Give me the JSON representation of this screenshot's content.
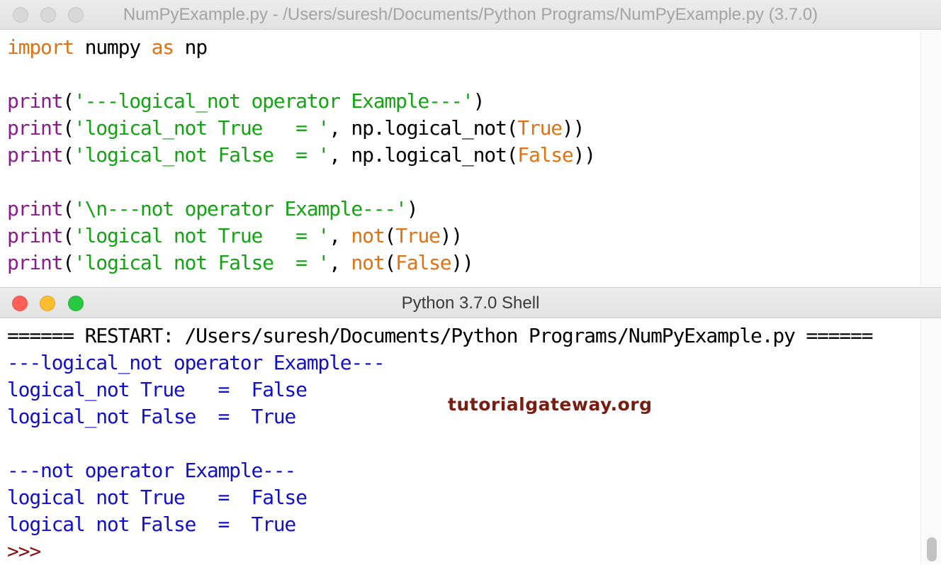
{
  "editor": {
    "title": "NumPyExample.py - /Users/suresh/Documents/Python Programs/NumPyExample.py (3.7.0)",
    "lines": [
      [
        {
          "t": "import",
          "c": "kw"
        },
        {
          "t": " numpy ",
          "c": ""
        },
        {
          "t": "as",
          "c": "kw"
        },
        {
          "t": " np",
          "c": ""
        }
      ],
      [],
      [
        {
          "t": "print",
          "c": "bi"
        },
        {
          "t": "(",
          "c": ""
        },
        {
          "t": "'---logical_not operator Example---'",
          "c": "str"
        },
        {
          "t": ")",
          "c": ""
        }
      ],
      [
        {
          "t": "print",
          "c": "bi"
        },
        {
          "t": "(",
          "c": ""
        },
        {
          "t": "'logical_not True   = '",
          "c": "str"
        },
        {
          "t": ", np.logical_not(",
          "c": ""
        },
        {
          "t": "True",
          "c": "kw"
        },
        {
          "t": "))",
          "c": ""
        }
      ],
      [
        {
          "t": "print",
          "c": "bi"
        },
        {
          "t": "(",
          "c": ""
        },
        {
          "t": "'logical_not False  = '",
          "c": "str"
        },
        {
          "t": ", np.logical_not(",
          "c": ""
        },
        {
          "t": "False",
          "c": "kw"
        },
        {
          "t": "))",
          "c": ""
        }
      ],
      [],
      [
        {
          "t": "print",
          "c": "bi"
        },
        {
          "t": "(",
          "c": ""
        },
        {
          "t": "'\\n---not operator Example---'",
          "c": "str"
        },
        {
          "t": ")",
          "c": ""
        }
      ],
      [
        {
          "t": "print",
          "c": "bi"
        },
        {
          "t": "(",
          "c": ""
        },
        {
          "t": "'logical not True   = '",
          "c": "str"
        },
        {
          "t": ", ",
          "c": ""
        },
        {
          "t": "not",
          "c": "kw"
        },
        {
          "t": "(",
          "c": ""
        },
        {
          "t": "True",
          "c": "kw"
        },
        {
          "t": "))",
          "c": ""
        }
      ],
      [
        {
          "t": "print",
          "c": "bi"
        },
        {
          "t": "(",
          "c": ""
        },
        {
          "t": "'logical not False  = '",
          "c": "str"
        },
        {
          "t": ", ",
          "c": ""
        },
        {
          "t": "not",
          "c": "kw"
        },
        {
          "t": "(",
          "c": ""
        },
        {
          "t": "False",
          "c": "kw"
        },
        {
          "t": "))",
          "c": ""
        }
      ]
    ]
  },
  "shell": {
    "title": "Python 3.7.0 Shell",
    "lines": [
      [
        {
          "t": "====== RESTART: /Users/suresh/Documents/Python Programs/NumPyExample.py ======",
          "c": "restart"
        }
      ],
      [
        {
          "t": "---logical_not operator Example---",
          "c": ""
        }
      ],
      [
        {
          "t": "logical_not True   =  False",
          "c": ""
        }
      ],
      [
        {
          "t": "logical_not False  =  True",
          "c": ""
        }
      ],
      [],
      [
        {
          "t": "---not operator Example---",
          "c": ""
        }
      ],
      [
        {
          "t": "logical not True   =  False",
          "c": ""
        }
      ],
      [
        {
          "t": "logical not False  =  True",
          "c": ""
        }
      ],
      [
        {
          "t": ">>>",
          "c": "prompt"
        }
      ]
    ]
  },
  "watermark": "tutorialgateway.org",
  "colors": {
    "close": "#ff5f57",
    "minimize": "#febc2e",
    "zoom": "#28c840",
    "keyword": "#e2720f",
    "builtin": "#8b1a8b",
    "string": "#13a313",
    "shell_output": "#1010c8"
  },
  "icons": [
    "close-icon",
    "minimize-icon",
    "zoom-icon"
  ]
}
